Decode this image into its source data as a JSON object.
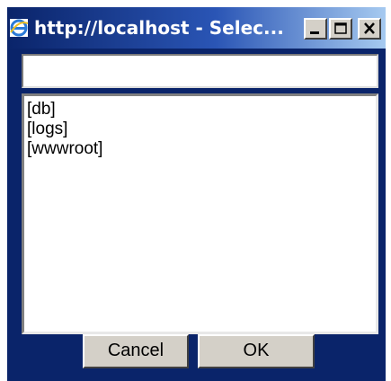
{
  "window": {
    "title": "http://localhost - Selec...",
    "icon": "ie-icon",
    "controls": {
      "minimize": "minimize-icon",
      "maximize": "maximize-icon",
      "close": "close-icon"
    },
    "colors": {
      "titlebar_start": "#0a246a",
      "titlebar_end": "#a6caf0",
      "frame": "#0a246a",
      "button_face": "#d4d0c8"
    }
  },
  "path_input": {
    "value": "",
    "placeholder": ""
  },
  "folder_list": {
    "items": [
      "[db]",
      "[logs]",
      "[wwwroot]"
    ]
  },
  "buttons": {
    "cancel_label": "Cancel",
    "ok_label": "OK"
  }
}
